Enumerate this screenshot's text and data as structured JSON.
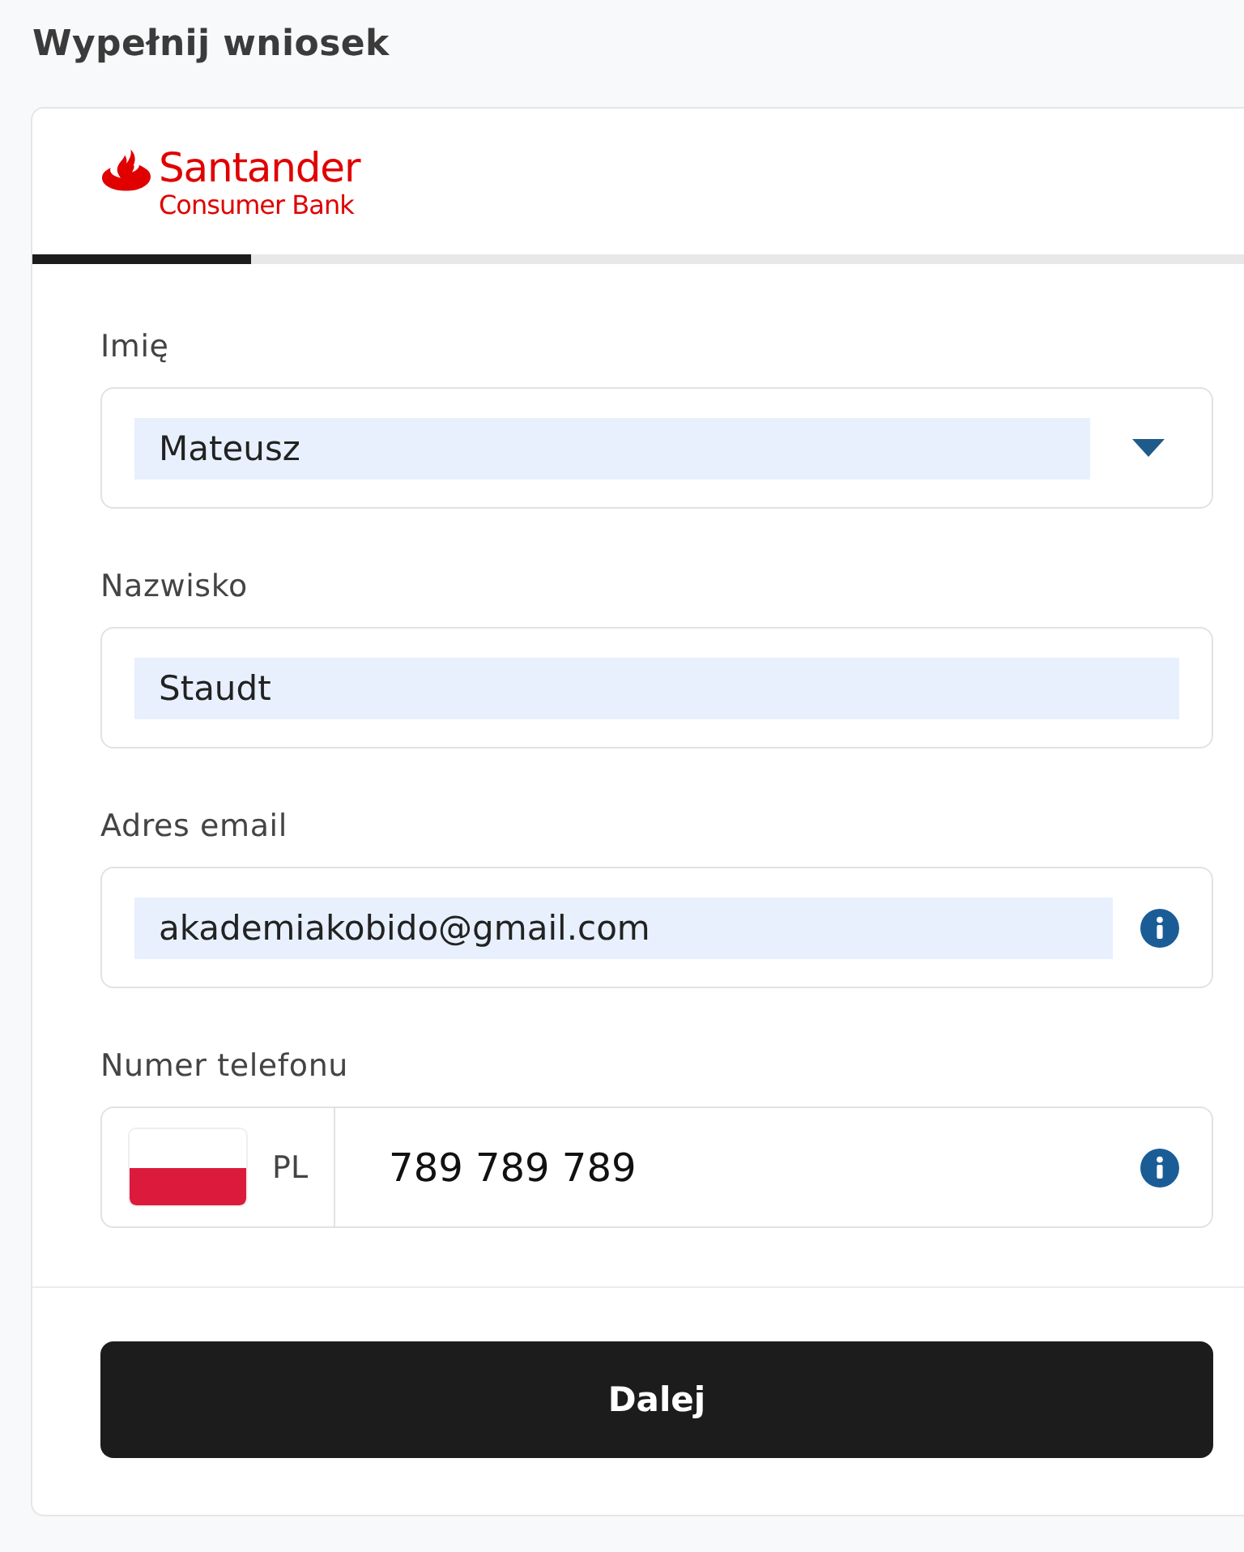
{
  "page_title": "Wypełnij wniosek",
  "form": {
    "logo": {
      "name": "Santander",
      "tagline": "Consumer Bank"
    },
    "progress": {
      "level": 0.18
    },
    "fields": [
      {
        "kind": "select",
        "label": "Imię",
        "value": "Mateusz",
        "autofilled": true,
        "info_icon": false
      },
      {
        "kind": "text",
        "label": "Nazwisko",
        "value": "Staudt",
        "autofilled": true,
        "info_icon": false
      },
      {
        "kind": "text",
        "label": "Adres email",
        "value": "akademiakobido@gmail.com",
        "autofilled": true,
        "info_icon": true
      },
      {
        "kind": "phone",
        "label": "Numer telefonu",
        "country": "PL",
        "value": "789 789 789",
        "autofilled": false,
        "info_icon": true
      }
    ],
    "submit_button": "Dalej"
  }
}
